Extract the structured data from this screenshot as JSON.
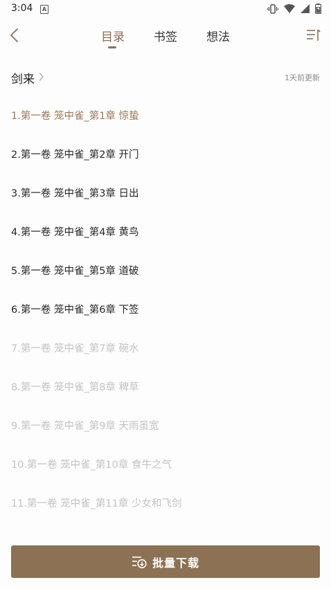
{
  "status_bar": {
    "time": "3:04",
    "a_badge": "A",
    "icons": [
      "vibrate-icon",
      "wifi-icon",
      "signal-icon",
      "battery-icon"
    ]
  },
  "header": {
    "tabs": [
      {
        "label": "目录",
        "active": true
      },
      {
        "label": "书签",
        "active": false
      },
      {
        "label": "想法",
        "active": false
      }
    ],
    "accent_color": "#8b6f52"
  },
  "book": {
    "title": "剑来",
    "updated": "1天前更新"
  },
  "chapters": [
    {
      "label": "1.第一卷 笼中雀_第1章 惊蛰",
      "state": "current"
    },
    {
      "label": "2.第一卷 笼中雀_第2章 开门",
      "state": "normal"
    },
    {
      "label": "3.第一卷 笼中雀_第3章 日出",
      "state": "normal"
    },
    {
      "label": "4.第一卷 笼中雀_第4章 黄鸟",
      "state": "normal"
    },
    {
      "label": "5.第一卷 笼中雀_第5章 道破",
      "state": "normal"
    },
    {
      "label": "6.第一卷 笼中雀_第6章 下签",
      "state": "normal"
    },
    {
      "label": "7.第一卷 笼中雀_第7章 碗水",
      "state": "dim"
    },
    {
      "label": "8.第一卷 笼中雀_第8章 稗草",
      "state": "dim"
    },
    {
      "label": "9.第一卷 笼中雀_第9章 天雨虽宽",
      "state": "dim"
    },
    {
      "label": "10.第一卷 笼中雀_第10章 食牛之气",
      "state": "dim"
    },
    {
      "label": "11.第一卷 笼中雀_第11章 少女和飞剑",
      "state": "dim"
    }
  ],
  "batch_download": {
    "label": "批量下载",
    "color": "#8c7154"
  }
}
